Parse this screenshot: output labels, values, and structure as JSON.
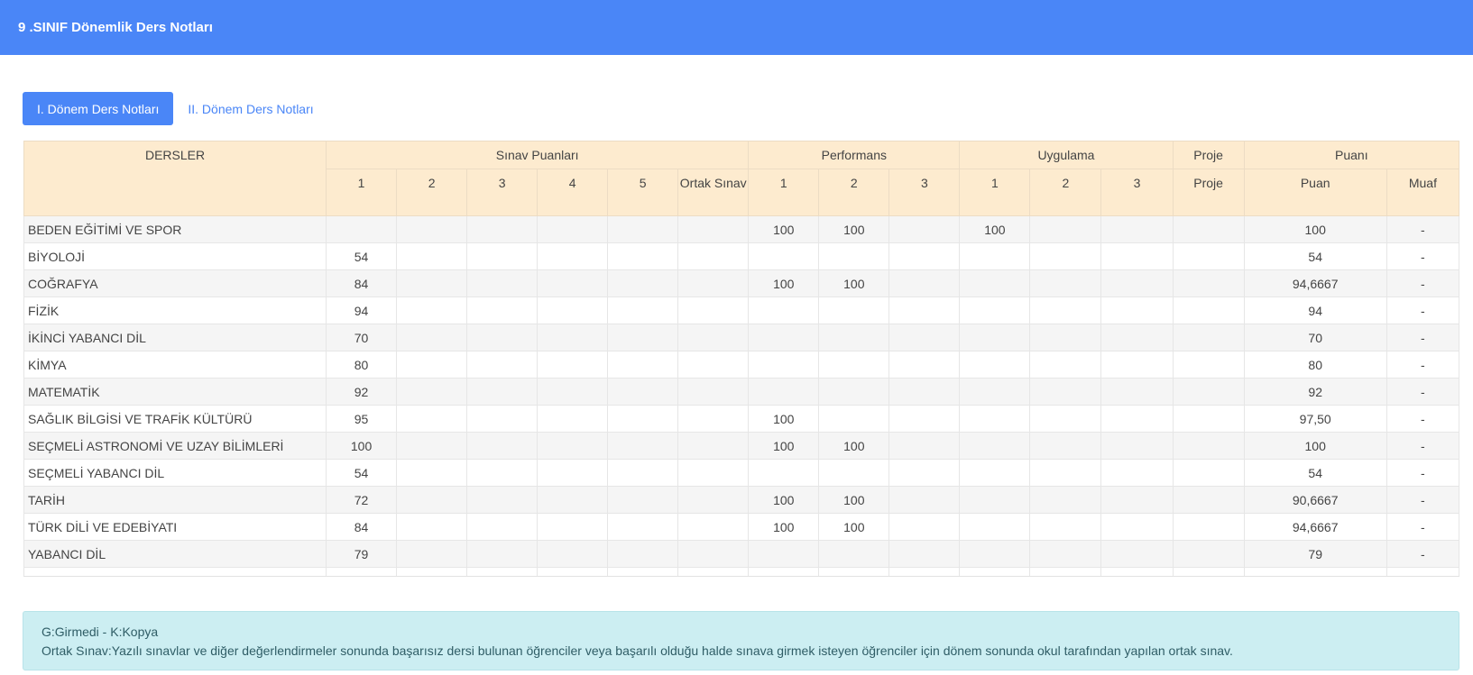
{
  "header": {
    "title": "9 .SINIF Dönemlik Ders Notları"
  },
  "tabs": {
    "active_label": "I. Dönem Ders Notları",
    "other_label": "II. Dönem Ders Notları"
  },
  "table": {
    "groups": {
      "lessons": "DERSLER",
      "exam": "Sınav Puanları",
      "performance": "Performans",
      "practice": "Uygulama",
      "project": "Proje",
      "score": "Puanı"
    },
    "subheaders": {
      "exam": [
        "1",
        "2",
        "3",
        "4",
        "5",
        "Ortak Sınav"
      ],
      "performance": [
        "1",
        "2",
        "3"
      ],
      "practice": [
        "1",
        "2",
        "3"
      ],
      "project": "Proje",
      "score": "Puan",
      "exempt": "Muaf"
    },
    "rows": [
      {
        "lesson": "BEDEN EĞİTİMİ VE SPOR",
        "exam": [
          "",
          "",
          "",
          "",
          "",
          ""
        ],
        "performance": [
          "100",
          "100",
          ""
        ],
        "practice": [
          "100",
          "",
          ""
        ],
        "project": "",
        "score": "100",
        "exempt": "-"
      },
      {
        "lesson": "BİYOLOJİ",
        "exam": [
          "54",
          "",
          "",
          "",
          "",
          ""
        ],
        "performance": [
          "",
          "",
          ""
        ],
        "practice": [
          "",
          "",
          ""
        ],
        "project": "",
        "score": "54",
        "exempt": "-"
      },
      {
        "lesson": "COĞRAFYA",
        "exam": [
          "84",
          "",
          "",
          "",
          "",
          ""
        ],
        "performance": [
          "100",
          "100",
          ""
        ],
        "practice": [
          "",
          "",
          ""
        ],
        "project": "",
        "score": "94,6667",
        "exempt": "-"
      },
      {
        "lesson": "FİZİK",
        "exam": [
          "94",
          "",
          "",
          "",
          "",
          ""
        ],
        "performance": [
          "",
          "",
          ""
        ],
        "practice": [
          "",
          "",
          ""
        ],
        "project": "",
        "score": "94",
        "exempt": "-"
      },
      {
        "lesson": "İKİNCİ YABANCI DİL",
        "exam": [
          "70",
          "",
          "",
          "",
          "",
          ""
        ],
        "performance": [
          "",
          "",
          ""
        ],
        "practice": [
          "",
          "",
          ""
        ],
        "project": "",
        "score": "70",
        "exempt": "-"
      },
      {
        "lesson": "KİMYA",
        "exam": [
          "80",
          "",
          "",
          "",
          "",
          ""
        ],
        "performance": [
          "",
          "",
          ""
        ],
        "practice": [
          "",
          "",
          ""
        ],
        "project": "",
        "score": "80",
        "exempt": "-"
      },
      {
        "lesson": "MATEMATİK",
        "exam": [
          "92",
          "",
          "",
          "",
          "",
          ""
        ],
        "performance": [
          "",
          "",
          ""
        ],
        "practice": [
          "",
          "",
          ""
        ],
        "project": "",
        "score": "92",
        "exempt": "-"
      },
      {
        "lesson": "SAĞLIK BİLGİSİ VE TRAFİK KÜLTÜRÜ",
        "exam": [
          "95",
          "",
          "",
          "",
          "",
          ""
        ],
        "performance": [
          "100",
          "",
          ""
        ],
        "practice": [
          "",
          "",
          ""
        ],
        "project": "",
        "score": "97,50",
        "exempt": "-"
      },
      {
        "lesson": "SEÇMELİ ASTRONOMİ VE UZAY BİLİMLERİ",
        "exam": [
          "100",
          "",
          "",
          "",
          "",
          ""
        ],
        "performance": [
          "100",
          "100",
          ""
        ],
        "practice": [
          "",
          "",
          ""
        ],
        "project": "",
        "score": "100",
        "exempt": "-"
      },
      {
        "lesson": "SEÇMELİ YABANCI DİL",
        "exam": [
          "54",
          "",
          "",
          "",
          "",
          ""
        ],
        "performance": [
          "",
          "",
          ""
        ],
        "practice": [
          "",
          "",
          ""
        ],
        "project": "",
        "score": "54",
        "exempt": "-"
      },
      {
        "lesson": "TARİH",
        "exam": [
          "72",
          "",
          "",
          "",
          "",
          ""
        ],
        "performance": [
          "100",
          "100",
          ""
        ],
        "practice": [
          "",
          "",
          ""
        ],
        "project": "",
        "score": "90,6667",
        "exempt": "-"
      },
      {
        "lesson": "TÜRK DİLİ VE EDEBİYATI",
        "exam": [
          "84",
          "",
          "",
          "",
          "",
          ""
        ],
        "performance": [
          "100",
          "100",
          ""
        ],
        "practice": [
          "",
          "",
          ""
        ],
        "project": "",
        "score": "94,6667",
        "exempt": "-"
      },
      {
        "lesson": "YABANCI DİL",
        "exam": [
          "79",
          "",
          "",
          "",
          "",
          ""
        ],
        "performance": [
          "",
          "",
          ""
        ],
        "practice": [
          "",
          "",
          ""
        ],
        "project": "",
        "score": "79",
        "exempt": "-"
      }
    ]
  },
  "info": {
    "line1": "G:Girmedi - K:Kopya",
    "line2": "Ortak Sınav:Yazılı sınavlar ve diğer değerlendirmeler sonunda başarısız dersi bulunan öğrenciler veya başarılı olduğu halde sınava girmek isteyen öğrenciler için dönem sonunda okul tarafından yapılan ortak sınav."
  }
}
